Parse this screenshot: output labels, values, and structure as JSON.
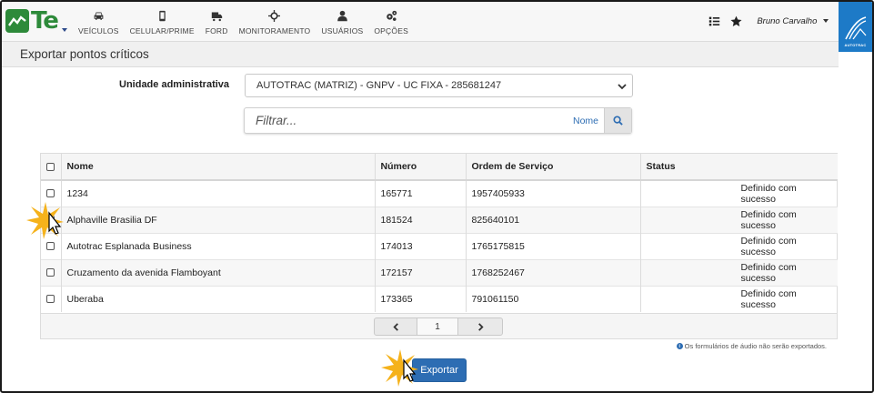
{
  "app": {
    "logo_text": "Te"
  },
  "nav": {
    "items": [
      {
        "label": "VEÍCULOS",
        "icon": "car-icon"
      },
      {
        "label": "CELULAR/PRIME",
        "icon": "phone-icon"
      },
      {
        "label": "FORD",
        "icon": "truck-icon"
      },
      {
        "label": "MONITORAMENTO",
        "icon": "crosshair-icon"
      },
      {
        "label": "USUÁRIOS",
        "icon": "user-icon"
      },
      {
        "label": "OPÇÕES",
        "icon": "gears-icon"
      }
    ]
  },
  "header": {
    "user_name": "Bruno Carvalho",
    "brand_text": "AUTOTRAC"
  },
  "page": {
    "title": "Exportar pontos críticos"
  },
  "form": {
    "unit_label": "Unidade administrativa",
    "unit_value": "AUTOTRAC (MATRIZ) - GNPV - UC FIXA - 285681247",
    "filter_placeholder": "Filtrar...",
    "filter_field": "Nome"
  },
  "table": {
    "columns": [
      "Nome",
      "Número",
      "Ordem de Serviço",
      "Status"
    ],
    "rows": [
      {
        "nome": "1234",
        "numero": "165771",
        "ordem": "1957405933",
        "status": "Definido com sucesso"
      },
      {
        "nome": "Alphaville Brasilia DF",
        "numero": "181524",
        "ordem": "825640101",
        "status": "Definido com sucesso"
      },
      {
        "nome": "Autotrac Esplanada Business",
        "numero": "174013",
        "ordem": "1765175815",
        "status": "Definido com sucesso"
      },
      {
        "nome": "Cruzamento da avenida Flamboyant",
        "numero": "172157",
        "ordem": "1768252467",
        "status": "Definido com sucesso"
      },
      {
        "nome": "Uberaba",
        "numero": "173365",
        "ordem": "791061150",
        "status": "Definido com sucesso"
      }
    ]
  },
  "pager": {
    "current_page": "1"
  },
  "note": "Os formulários de áudio não serão exportados.",
  "actions": {
    "export_label": "Exportar"
  },
  "colors": {
    "brand_green": "#2d8a3a",
    "primary_blue": "#2d6db3",
    "brand_blue": "#1d7ac7"
  }
}
